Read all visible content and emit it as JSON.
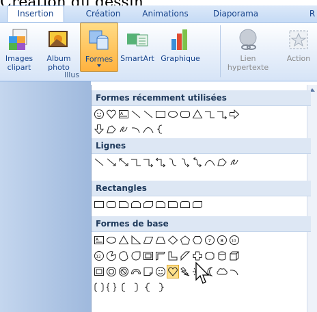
{
  "caption": "Création du dessin",
  "tabs": [
    {
      "label": "Insertion",
      "active": true
    },
    {
      "label": "Création",
      "active": false
    },
    {
      "label": "Animations",
      "active": false
    },
    {
      "label": "Diaporama",
      "active": false
    },
    {
      "label": "R",
      "active": false
    }
  ],
  "ribbon": {
    "images_clipart": "Images clipart",
    "album_photo": "Album photo",
    "formes": "Formes",
    "smartart": "SmartArt",
    "graphique": "Graphique",
    "lien_hypertexte": "Lien hypertexte",
    "action": "Action",
    "group_illustrations": "Illus"
  },
  "dropdown": {
    "sections": [
      {
        "title": "Formes récemment utilisées"
      },
      {
        "title": "Lignes"
      },
      {
        "title": "Rectangles"
      },
      {
        "title": "Formes de base"
      }
    ]
  },
  "colors": {
    "selected": "#ffc45a",
    "ribbon_text": "#15428b",
    "section_bg": "#dde7f4"
  },
  "icons": [
    "clipart-icon",
    "album-icon",
    "shapes-icon",
    "smartart-icon",
    "chart-icon",
    "hyperlink-icon",
    "action-icon",
    "scroll-up-icon",
    "mouse-cursor-icon"
  ]
}
